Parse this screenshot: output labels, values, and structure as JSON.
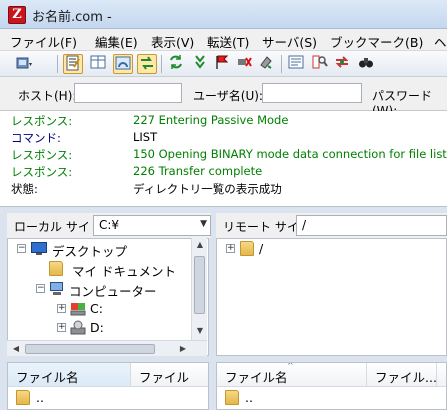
{
  "window": {
    "icon_letter": "Fz",
    "title": "お名前.com -"
  },
  "menu": [
    "ファイル(F)",
    "編集(E)",
    "表示(V)",
    "転送(T)",
    "サーバ(S)",
    "ブックマーク(B)",
    "ヘ"
  ],
  "quickconnect": {
    "host_label": "ホスト(H):",
    "user_label": "ユーザ名(U):",
    "password_label": "パスワード(W):",
    "host_value": "",
    "user_value": ""
  },
  "log": [
    {
      "type": "レスポンス:",
      "message": "227 Entering Passive Mode",
      "kind": "response"
    },
    {
      "type": "コマンド:",
      "message": "LIST",
      "kind": "command"
    },
    {
      "type": "レスポンス:",
      "message": "150 Opening BINARY mode data connection for file list",
      "kind": "response"
    },
    {
      "type": "レスポンス:",
      "message": "226 Transfer complete",
      "kind": "response"
    },
    {
      "type": "状態:",
      "message": "ディレクトリ一覧の表示成功",
      "kind": "status"
    }
  ],
  "local": {
    "site_label": "ローカル サイト:",
    "path": "C:¥",
    "tree": [
      {
        "label": "デスクトップ",
        "expander": "−",
        "icon": "desktop-icon"
      },
      {
        "label": "マイ ドキュメント",
        "expander": "",
        "icon": "documents-folder-icon"
      },
      {
        "label": "コンピューター",
        "expander": "−",
        "icon": "computer-icon"
      },
      {
        "label": "C:",
        "expander": "+",
        "icon": "drive-icon"
      },
      {
        "label": "D:",
        "expander": "+",
        "icon": "drive-icon"
      }
    ],
    "columns": [
      "ファイル名",
      "ファイル"
    ],
    "files": [
      ".."
    ]
  },
  "remote": {
    "site_label": "リモート サイト:",
    "path": "/",
    "tree": [
      {
        "label": "/",
        "expander": "+",
        "icon": "folder-icon"
      }
    ],
    "columns": [
      "ファイル名",
      "ファイル...",
      ""
    ],
    "files": [
      ".."
    ]
  },
  "colors": {
    "response": "#008000",
    "command": "#000080",
    "status": "#000000"
  }
}
